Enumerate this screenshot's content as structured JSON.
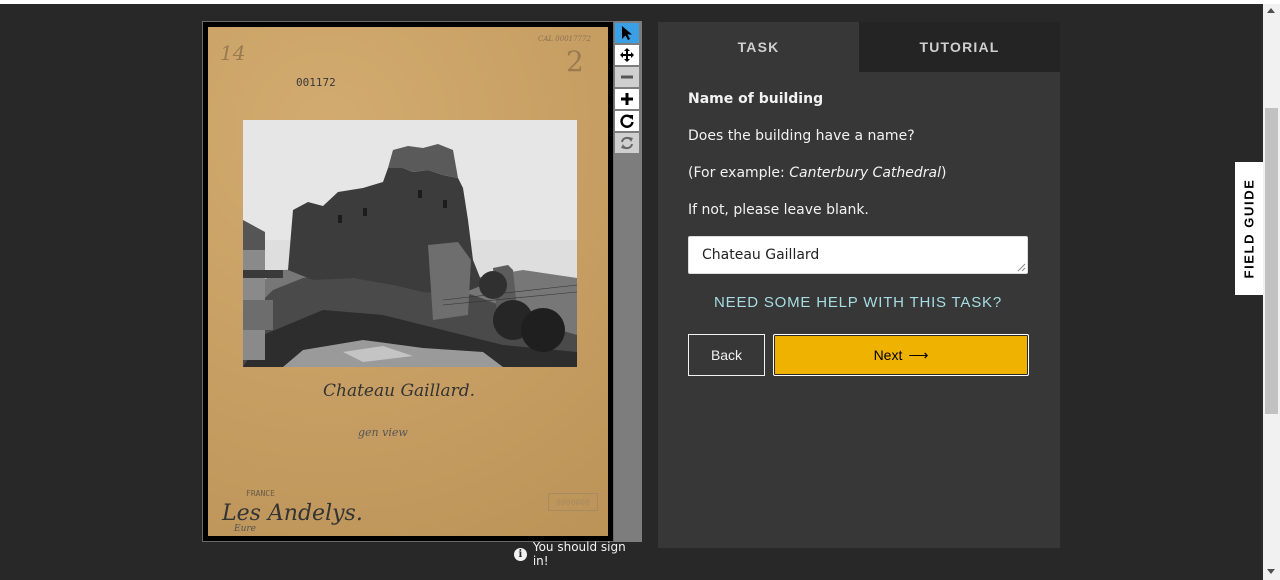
{
  "subject": {
    "card_number": "14",
    "catalog_code": "001172",
    "corner_number": "2",
    "corner_ref": "CAL 00017772",
    "caption": "Chateau Gaillard.",
    "sub_caption": "gen view",
    "country_stamp": "FRANCE",
    "location": "Les Andelys.",
    "department": "Eure",
    "box_stamp": "0000000"
  },
  "tools": [
    {
      "name": "pointer-icon",
      "state": "active"
    },
    {
      "name": "move-icon",
      "state": "normal"
    },
    {
      "name": "zoom-out-icon",
      "state": "disabled"
    },
    {
      "name": "zoom-in-icon",
      "state": "normal"
    },
    {
      "name": "rotate-icon",
      "state": "normal"
    },
    {
      "name": "reset-icon",
      "state": "disabled"
    }
  ],
  "signin": {
    "text": "You should sign in!"
  },
  "tabs": {
    "task": "TASK",
    "tutorial": "TUTORIAL"
  },
  "task": {
    "title": "Name of building",
    "question": "Does the building have a name?",
    "example_prefix": "(For example: ",
    "example_name": "Canterbury Cathedral",
    "example_suffix": ")",
    "blank_note": "If not, please leave blank.",
    "answer_value": "Chateau Gaillard",
    "help_link": "NEED SOME HELP WITH THIS TASK?",
    "back_label": "Back",
    "next_label": "Next",
    "next_arrow": "⟶"
  },
  "field_guide": {
    "label": "FIELD GUIDE"
  },
  "colors": {
    "accent": "#f0b200",
    "panel": "#373737",
    "background": "#282828",
    "link": "#a6dde3",
    "active_tool": "#3b9fe6"
  }
}
